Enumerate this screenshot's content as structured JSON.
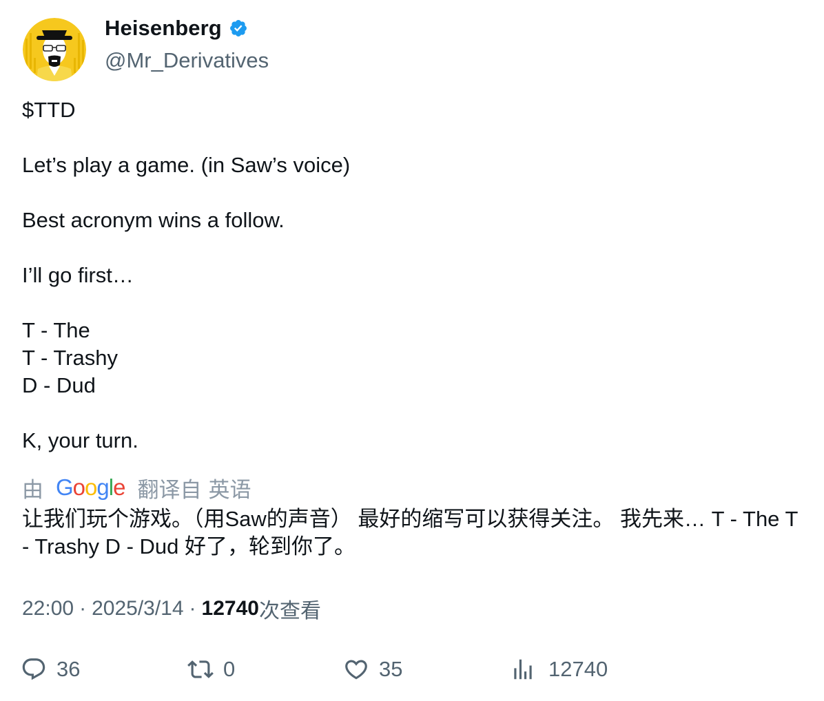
{
  "author": {
    "display_name": "Heisenberg",
    "handle": "@Mr_Derivatives",
    "verified": true,
    "avatar_icon": "heisenberg-avatar-icon",
    "avatar_bg_color": "#f5c518"
  },
  "tweet": {
    "lines": [
      "$TTD",
      "",
      "Let’s play a game. (in Saw’s voice)",
      "",
      "Best acronym wins a follow.",
      "",
      "I’ll go first…",
      "",
      "T - The",
      "T - Trashy",
      "D - Dud",
      "",
      "K, your turn."
    ]
  },
  "translation": {
    "by_label": "由",
    "provider": "Google",
    "translated_from": "翻译自",
    "source_language": "英语",
    "text": "让我们玩个游戏。（用Saw的声音） 最好的缩写可以获得关注。 我先来… T - The T - Trashy D - Dud 好了，轮到你了。"
  },
  "meta": {
    "time": "22:00",
    "dot": "·",
    "date": "2025/3/14",
    "views_count": "12740",
    "views_label": "次查看"
  },
  "actions": {
    "reply": {
      "icon": "reply-icon",
      "count": "36"
    },
    "retweet": {
      "icon": "retweet-icon",
      "count": "0"
    },
    "like": {
      "icon": "heart-icon",
      "count": "35"
    },
    "views": {
      "icon": "bar-chart-icon",
      "count": "12740"
    }
  },
  "colors": {
    "text_primary": "#0f1419",
    "text_secondary": "#536471",
    "verified_blue": "#1d9bf0",
    "google_blue": "#4285f4",
    "google_red": "#ea4335",
    "google_yellow": "#fbbc05",
    "google_green": "#34a853"
  }
}
